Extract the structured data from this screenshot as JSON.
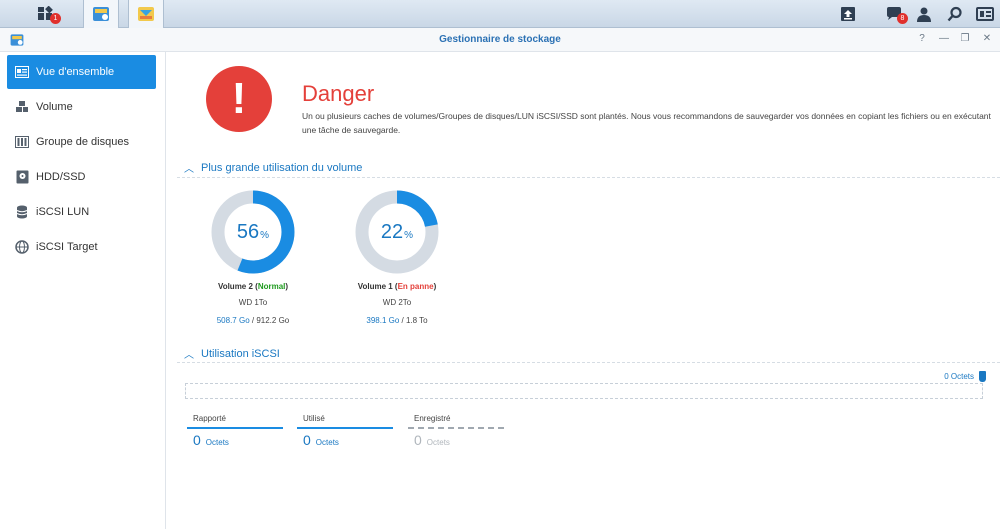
{
  "taskbar": {
    "main_menu_badge": "1",
    "notification_badge": "8"
  },
  "window": {
    "title": "Gestionnaire de stockage",
    "help": "?",
    "minimize": "—",
    "restore": "❐",
    "close": "✕"
  },
  "sidebar": {
    "items": [
      {
        "label": "Vue d'ensemble",
        "icon": "overview-icon"
      },
      {
        "label": "Volume",
        "icon": "volume-icon"
      },
      {
        "label": "Groupe de disques",
        "icon": "disk-group-icon"
      },
      {
        "label": "HDD/SSD",
        "icon": "hdd-icon"
      },
      {
        "label": "iSCSI LUN",
        "icon": "iscsi-lun-icon"
      },
      {
        "label": "iSCSI Target",
        "icon": "iscsi-target-icon"
      }
    ]
  },
  "status": {
    "title": "Danger",
    "message": "Un ou plusieurs caches de volumes/Groupes de disques/LUN iSCSI/SSD sont plantés. Nous vous recommandons de sauvegarder vos données en copiant les fichiers ou en exécutant une tâche de sauvegarde.",
    "color": "#e4403a"
  },
  "volume_usage": {
    "title": "Plus grande utilisation du volume",
    "volumes": [
      {
        "pct": "56",
        "pct_unit": "%",
        "name": "Volume 2 (",
        "state": "Normal",
        "name_end": ")",
        "disk": "WD 1To",
        "used": "508.7 Go",
        "sep": " / ",
        "total": "912.2 Go",
        "usage": 0.56
      },
      {
        "pct": "22",
        "pct_unit": "%",
        "name": "Volume 1 (",
        "state": "En panne",
        "name_end": ")",
        "disk": "WD 2To",
        "used": "398.1 Go",
        "sep": " / ",
        "total": "1.8 To",
        "usage": 0.22
      }
    ],
    "colors": {
      "used": "#1a8ce2",
      "free": "#d4dbe3"
    }
  },
  "iscsi_usage": {
    "title": "Utilisation iSCSI",
    "total": "0 Octets",
    "stats": [
      {
        "label": "Rapporté",
        "value": "0",
        "unit": "Octets"
      },
      {
        "label": "Utilisé",
        "value": "0",
        "unit": "Octets"
      },
      {
        "label": "Enregistré",
        "value": "0",
        "unit": "Octets"
      }
    ]
  }
}
